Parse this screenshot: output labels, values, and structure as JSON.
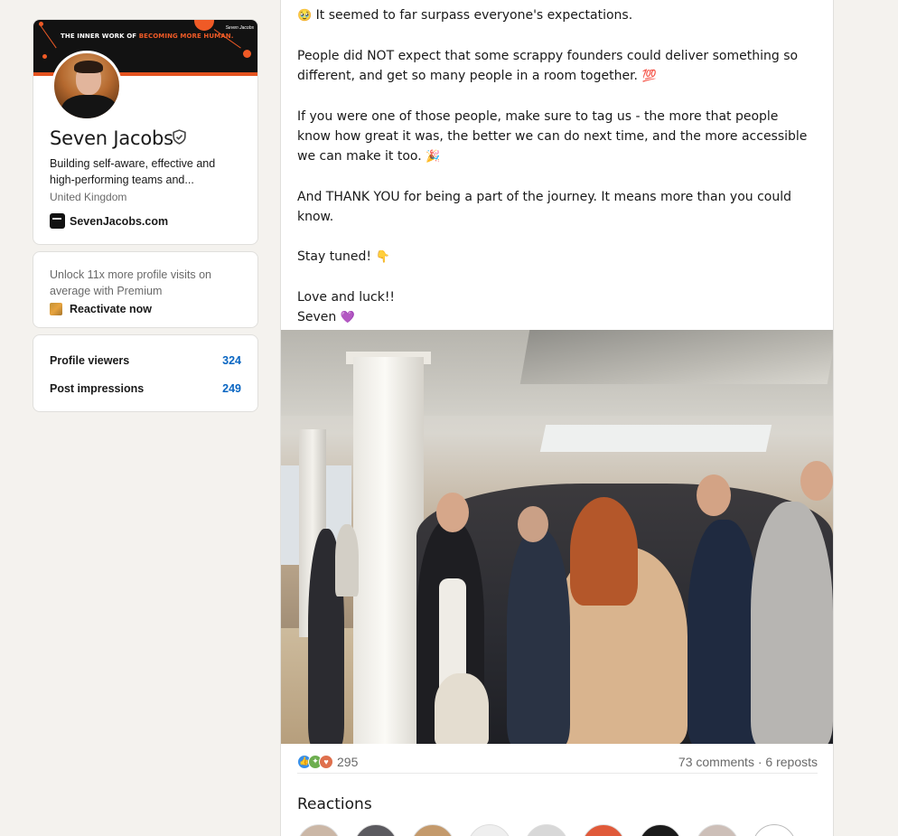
{
  "profile": {
    "banner": {
      "title_prefix": "THE INNER WORK OF ",
      "title_highlight": "BECOMING MORE HUMAN.",
      "brand": "Seven Jacobs"
    },
    "name": "Seven Jacobs",
    "headline_line1": "Building self-aware, effective and",
    "headline_line2": "high-performing teams and...",
    "location": "United Kingdom",
    "website": "SevenJacobs.com"
  },
  "premium": {
    "text": "Unlock 11x more profile visits on average with Premium",
    "cta": "Reactivate now"
  },
  "stats": [
    {
      "label": "Profile viewers",
      "value": "324"
    },
    {
      "label": "Post impressions",
      "value": "249"
    }
  ],
  "post": {
    "paragraphs": [
      "It seemed to far surpass everyone's expectations.",
      "People did NOT expect that some scrappy founders could deliver something so different, and get so many people in a room together.",
      "If you were one of those people, make sure to tag us - the more that people know how great it was, the better we can do next time, and the more accessible we can make it too.",
      "And THANK YOU for being a part of the journey. It means more than you could know.",
      "Stay tuned!",
      "Love and luck!!",
      "Seven"
    ],
    "emojis": {
      "p0": "🥹",
      "p1": "💯",
      "p2": "🎉",
      "p4": "👇",
      "p6": "💜"
    },
    "reaction_count": "295",
    "comments": "73 comments",
    "reposts": "6 reposts",
    "separator": " · ",
    "reactions_heading": "Reactions"
  },
  "colors": {
    "accent": "#0a66c2",
    "banner_orange": "#ef5a26",
    "page_bg": "#f4f2ee"
  }
}
